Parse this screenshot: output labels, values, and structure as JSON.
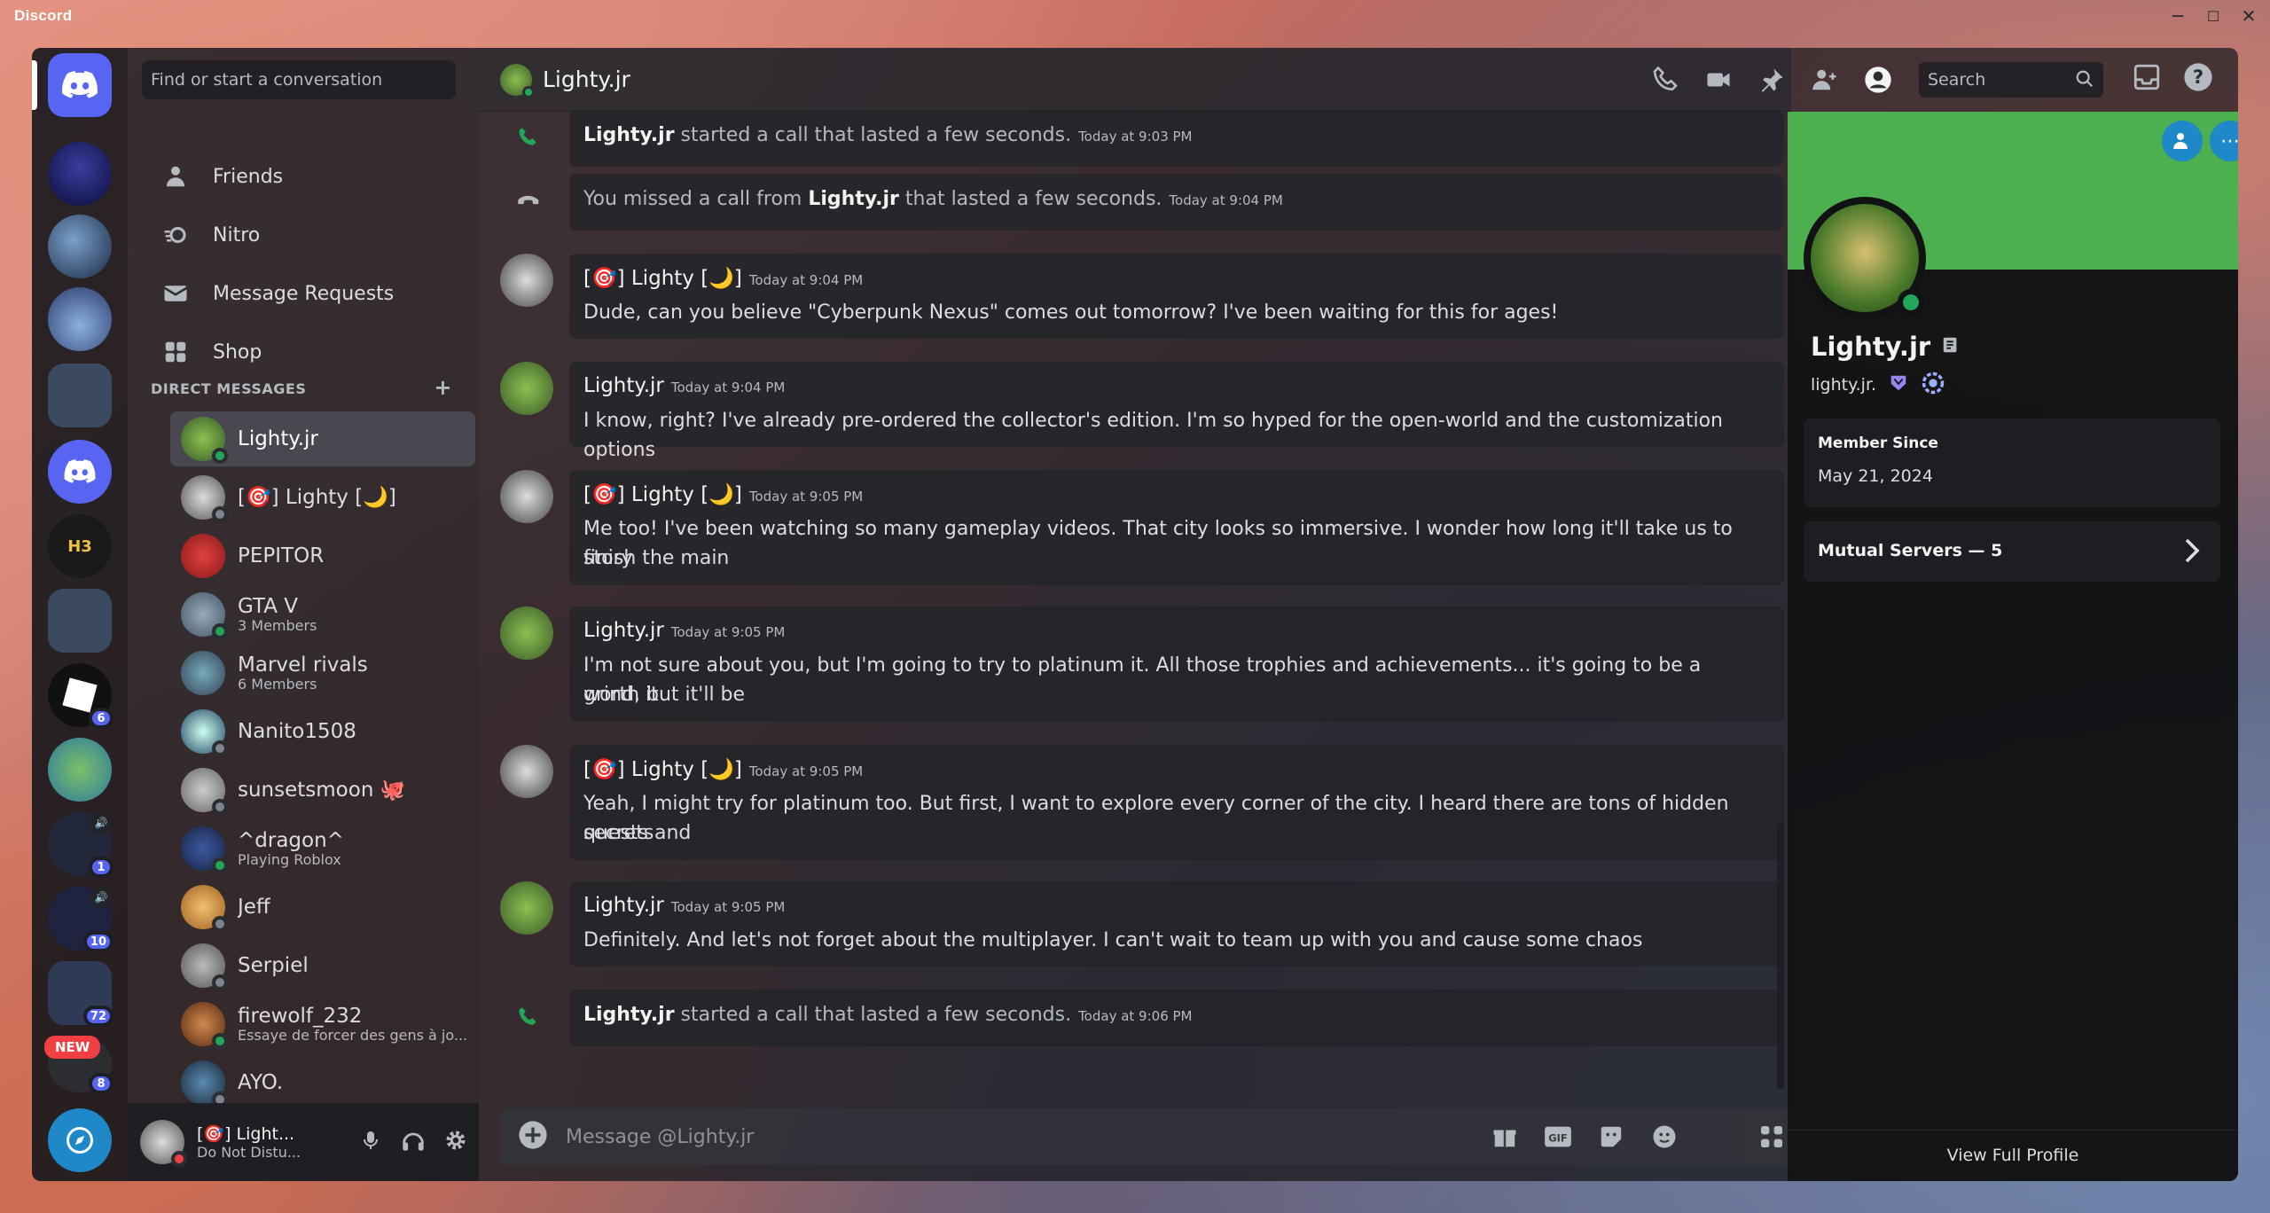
{
  "app": {
    "name": "Discord"
  },
  "colors": {
    "accent": "#5865f2",
    "banner": "#4caf50",
    "online": "#23a55a",
    "dnd": "#f23f43",
    "mention": "#f23f43"
  },
  "sidebar": {
    "search_placeholder": "Find or start a conversation",
    "nav": [
      {
        "label": "Friends",
        "icon": "friends-icon"
      },
      {
        "label": "Nitro",
        "icon": "nitro-icon"
      },
      {
        "label": "Message Requests",
        "icon": "envelope-icon"
      },
      {
        "label": "Shop",
        "icon": "shop-icon"
      }
    ],
    "dm_header": "DIRECT MESSAGES",
    "dms": [
      {
        "name": "Lighty.jr",
        "sub": "",
        "status": "online"
      },
      {
        "name": "[🎯] Lighty [🌙]",
        "sub": "",
        "status": "offline"
      },
      {
        "name": "PEPITOR",
        "sub": "",
        "status": "none"
      },
      {
        "name": "GTA V",
        "sub": "3 Members",
        "status": "online"
      },
      {
        "name": "Marvel rivals",
        "sub": "6 Members",
        "status": "none"
      },
      {
        "name": "Nanito1508",
        "sub": "",
        "status": "offline"
      },
      {
        "name": "sunsetsmoon 🐙",
        "sub": "",
        "status": "offline"
      },
      {
        "name": "^dragon^",
        "sub": "Playing Roblox",
        "status": "online"
      },
      {
        "name": "Jeff",
        "sub": "",
        "status": "offline"
      },
      {
        "name": "Serpiel",
        "sub": "",
        "status": "offline"
      },
      {
        "name": "firewolf_232",
        "sub": "Essaye de forcer des gens à jo...",
        "status": "online"
      },
      {
        "name": "AYO.",
        "sub": "",
        "status": "offline"
      }
    ],
    "servers": [
      {
        "badge": ""
      },
      {
        "badge": ""
      },
      {
        "badge": ""
      },
      {
        "badge": ""
      },
      {
        "badge": ""
      },
      {
        "badge": ""
      },
      {
        "badge": ""
      },
      {
        "badge": "6"
      },
      {
        "badge": ""
      },
      {
        "badge": "1"
      },
      {
        "badge": "10"
      },
      {
        "badge": "72"
      },
      {
        "badge": "8",
        "label": "NEW"
      }
    ],
    "user": {
      "name": "[🎯] Light...",
      "status": "Do Not Distu..."
    }
  },
  "chat": {
    "title": "Lighty.jr",
    "search_placeholder": "Search",
    "composer_placeholder": "Message @Lighty.jr",
    "messages": [
      {
        "type": "sys",
        "who": "Lighty.jr",
        "text": " started a call that lasted a few seconds.",
        "time": "Today at 9:03 PM"
      },
      {
        "type": "sys_missed",
        "pre": "You missed a call from ",
        "who": "Lighty.jr",
        "text": " that lasted a few seconds.",
        "time": "Today at 9:04 PM"
      },
      {
        "type": "msg",
        "author": "[🎯] Lighty [🌙]",
        "time": "Today at 9:04 PM",
        "lines": [
          "Dude, can you believe \"Cyberpunk Nexus\" comes out tomorrow? I've been waiting for this for ages!"
        ]
      },
      {
        "type": "msg",
        "author": "Lighty.jr",
        "time": "Today at 9:04 PM",
        "lines": [
          "I know, right? I've already pre-ordered the collector's edition. I'm so hyped for the open-world and the customization options"
        ]
      },
      {
        "type": "msg",
        "author": "[🎯] Lighty [🌙]",
        "time": "Today at 9:05 PM",
        "lines": [
          "Me too! I've been watching so many gameplay videos. That city looks so immersive. I wonder how long it'll take us to finish the main",
          "story"
        ]
      },
      {
        "type": "msg",
        "author": "Lighty.jr",
        "time": "Today at 9:05 PM",
        "lines": [
          "I'm not sure about you, but I'm going to try to platinum it. All those trophies and achievements... it's going to be a grind, but it'll be",
          "worth it"
        ]
      },
      {
        "type": "msg",
        "author": "[🎯] Lighty [🌙]",
        "time": "Today at 9:05 PM",
        "lines": [
          "Yeah, I might try for platinum too. But first, I want to explore every corner of the city. I heard there are tons of hidden quests and",
          "secrets"
        ]
      },
      {
        "type": "msg",
        "author": "Lighty.jr",
        "time": "Today at 9:05 PM",
        "lines": [
          "Definitely. And let's not forget about the multiplayer. I can't wait to team up with you and cause some chaos"
        ]
      },
      {
        "type": "sys",
        "who": "Lighty.jr",
        "text": " started a call that lasted a few seconds.",
        "time": "Today at 9:06 PM"
      }
    ]
  },
  "profile": {
    "display_name": "Lighty.jr",
    "username": "lighty.jr.",
    "member_since_label": "Member Since",
    "member_since": "May 21, 2024",
    "mutual_servers": "Mutual Servers — 5",
    "view_full": "View Full Profile"
  }
}
